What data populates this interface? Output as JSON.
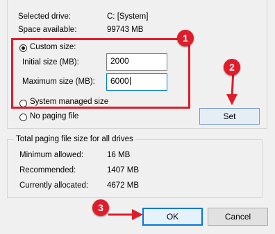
{
  "drive_info": {
    "selected_drive_label": "Selected drive:",
    "selected_drive_value": "C:  [System]",
    "space_available_label": "Space available:",
    "space_available_value": "99743 MB"
  },
  "custom_size": {
    "radio_label": "Custom size:",
    "checked": true,
    "initial_label": "Initial size (MB):",
    "initial_value": "2000",
    "maximum_label": "Maximum size (MB):",
    "maximum_value": "6000"
  },
  "system_managed": {
    "radio_label": "System managed size",
    "checked": false
  },
  "no_paging": {
    "radio_label": "No paging file",
    "checked": false
  },
  "set_button": "Set",
  "totals": {
    "title": "Total paging file size for all drives",
    "min_label": "Minimum allowed:",
    "min_value": "16 MB",
    "recommended_label": "Recommended:",
    "recommended_value": "1407 MB",
    "current_label": "Currently allocated:",
    "current_value": "4672 MB"
  },
  "footer": {
    "ok": "OK",
    "cancel": "Cancel"
  },
  "annotations": {
    "marker1": "1",
    "marker2": "2",
    "marker3": "3"
  },
  "colors": {
    "annotation_red": "#e01c2a",
    "focus_blue": "#0078d7"
  }
}
